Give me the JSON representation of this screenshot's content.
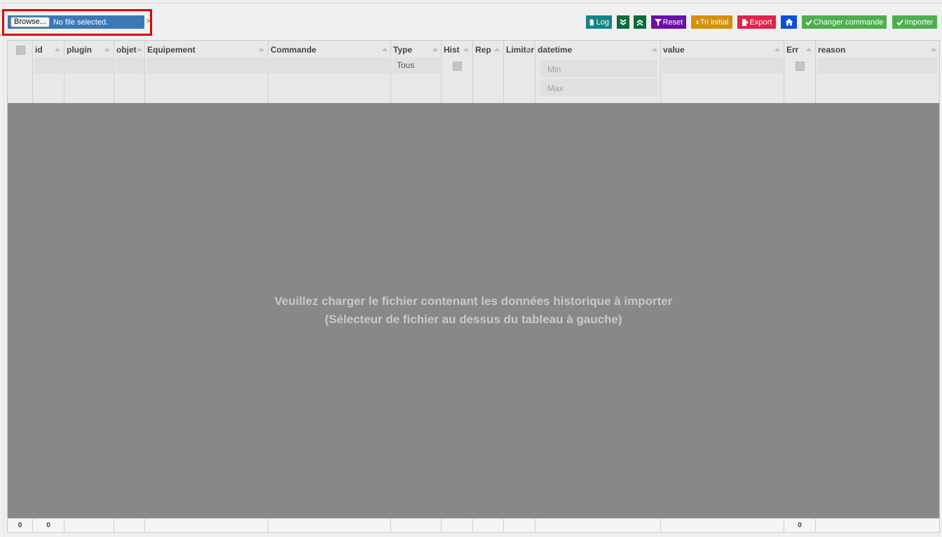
{
  "file_picker": {
    "browse_label": "Browse...",
    "status": "No file selected.",
    "arrow": ">"
  },
  "toolbar": {
    "log": "Log",
    "reset": "Reset",
    "tri_initial": "Tri initial",
    "export": "Export",
    "changer_commande": "Changer commande",
    "importer": "Importer",
    "colors": {
      "log": "#138585",
      "expand": "#0b6b3c",
      "collapse": "#0b6b3c",
      "reset": "#6a0fa8",
      "tri_initial": "#d4900a",
      "export": "#e0234a",
      "home": "#0a4fd6",
      "changer_commande": "#4caf4c",
      "importer": "#4caf4c"
    },
    "icons": {
      "log": "file-icon",
      "expand": "chevrons-down-icon",
      "collapse": "chevrons-up-icon",
      "reset": "filter-icon",
      "tri_initial": "sort-icon",
      "export": "file-export-icon",
      "home": "home-icon",
      "changer_commande": "check-icon",
      "importer": "check-icon"
    }
  },
  "table": {
    "columns": {
      "id": "id",
      "plugin": "plugin",
      "objet": "objet",
      "equipement": "Equipement",
      "commande": "Commande",
      "type": "Type",
      "hist": "Hist",
      "rep": "Rep",
      "limiter": "Limiter",
      "datetime": "datetime",
      "value": "value",
      "err": "Err",
      "reason": "reason"
    },
    "filters": {
      "type": "Tous",
      "datetime_min": "Min",
      "datetime_max": "Max"
    },
    "empty_message_line1": "Veuillez charger le fichier contenant les données historique à importer",
    "empty_message_line2": "(Sélecteur de fichier au dessus du tableau à gauche)",
    "footer": {
      "select_count": "0",
      "id_count": "0",
      "err_count": "0"
    }
  }
}
